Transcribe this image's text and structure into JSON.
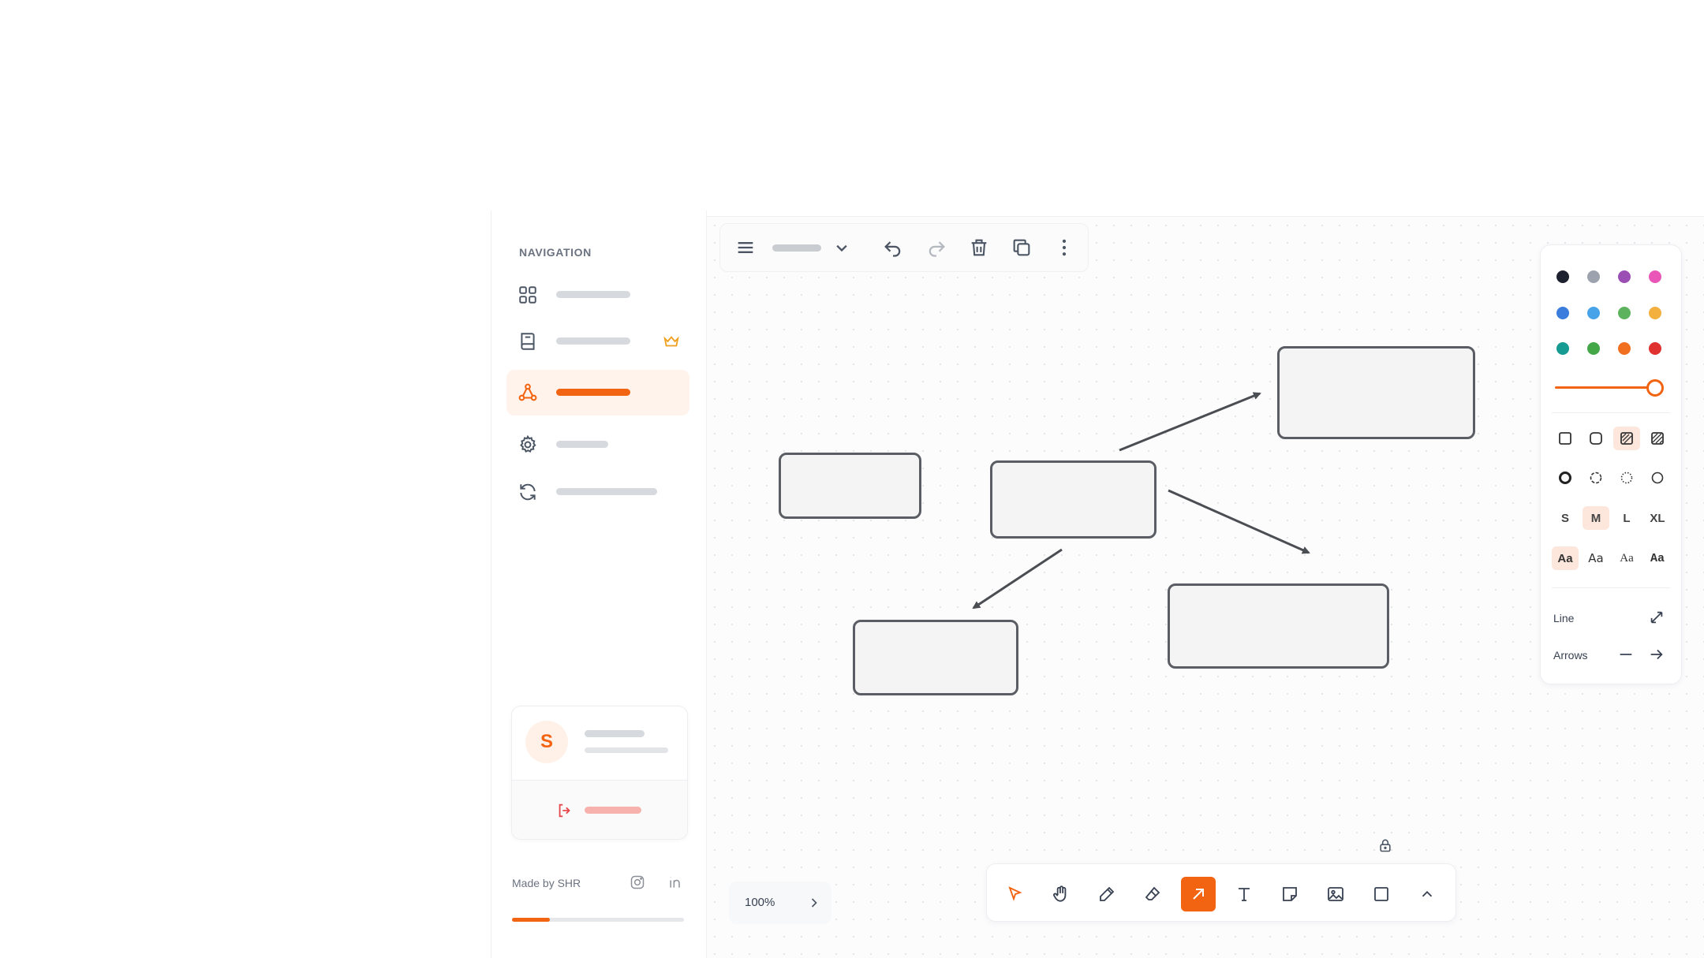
{
  "sidebar": {
    "title": "NAVIGATION",
    "items": [
      {
        "icon": "grid-icon",
        "active": false
      },
      {
        "icon": "book-icon",
        "active": false,
        "badge": "crown-icon"
      },
      {
        "icon": "share-nodes-icon",
        "active": true
      },
      {
        "icon": "gear-icon",
        "active": false
      },
      {
        "icon": "refresh-icon",
        "active": false
      }
    ],
    "profile": {
      "initial": "S"
    },
    "footer": {
      "made_by": "Made by SHR",
      "progress": 0.22
    }
  },
  "toolbar": {
    "icons": [
      "menu-icon",
      "chevron-down-icon",
      "undo-icon",
      "redo-icon",
      "trash-icon",
      "copy-icon",
      "more-vertical-icon"
    ]
  },
  "properties": {
    "colors": [
      "#1e2230",
      "#9ca3af",
      "#9b4fb4",
      "#e956b8",
      "#3b7ddd",
      "#48a3e8",
      "#5db35d",
      "#f4b03e",
      "#169b93",
      "#43a647",
      "#f07020",
      "#e03131"
    ],
    "opacity": 1,
    "sizes": [
      "S",
      "M",
      "L",
      "XL"
    ],
    "selected_size": "M",
    "font_sample": "Aa",
    "line_label": "Line",
    "arrows_label": "Arrows"
  },
  "zoom": {
    "level": "100%"
  },
  "bottom_tools": [
    "cursor-icon",
    "hand-icon",
    "pencil-icon",
    "eraser-icon",
    "arrow-icon",
    "text-icon",
    "sticky-note-icon",
    "image-icon",
    "rectangle-icon",
    "chevron-up-icon"
  ],
  "active_tool": "arrow-icon",
  "accent": "#f26411"
}
